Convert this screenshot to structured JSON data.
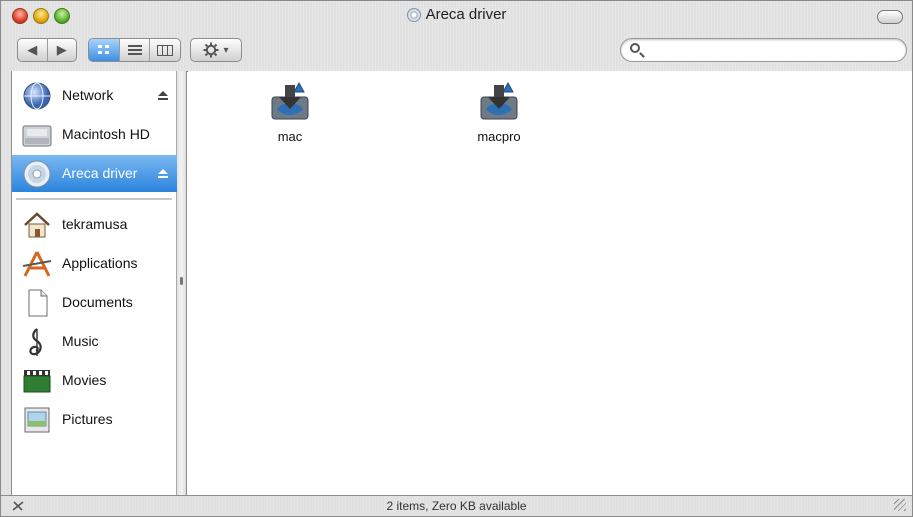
{
  "window": {
    "title": "Areca driver"
  },
  "toolbar": {
    "view_modes": [
      "icon",
      "list",
      "column"
    ],
    "action_icon": "gear-icon",
    "action_caret": "▾",
    "back_label": "◀",
    "forward_label": "▶",
    "search_value": "",
    "search_placeholder": ""
  },
  "sidebar": {
    "devices": [
      {
        "label": "Network",
        "icon": "network-icon",
        "eject": true,
        "selected": false
      },
      {
        "label": "Macintosh HD",
        "icon": "hard-drive-icon",
        "eject": false,
        "selected": false
      },
      {
        "label": "Areca driver",
        "icon": "cd-icon",
        "eject": true,
        "selected": true
      }
    ],
    "places": [
      {
        "label": "tekramusa",
        "icon": "home-icon"
      },
      {
        "label": "Applications",
        "icon": "applications-icon"
      },
      {
        "label": "Documents",
        "icon": "documents-icon"
      },
      {
        "label": "Music",
        "icon": "music-icon"
      },
      {
        "label": "Movies",
        "icon": "movies-icon"
      },
      {
        "label": "Pictures",
        "icon": "pictures-icon"
      }
    ]
  },
  "content": {
    "items": [
      {
        "name": "mac",
        "icon": "installer-package-icon"
      },
      {
        "name": "macpro",
        "icon": "installer-package-icon"
      }
    ]
  },
  "status": {
    "text": "2 items, Zero KB available"
  },
  "colors": {
    "selection": "#2b84dd",
    "toolbar_active": "#3d8fe0"
  }
}
